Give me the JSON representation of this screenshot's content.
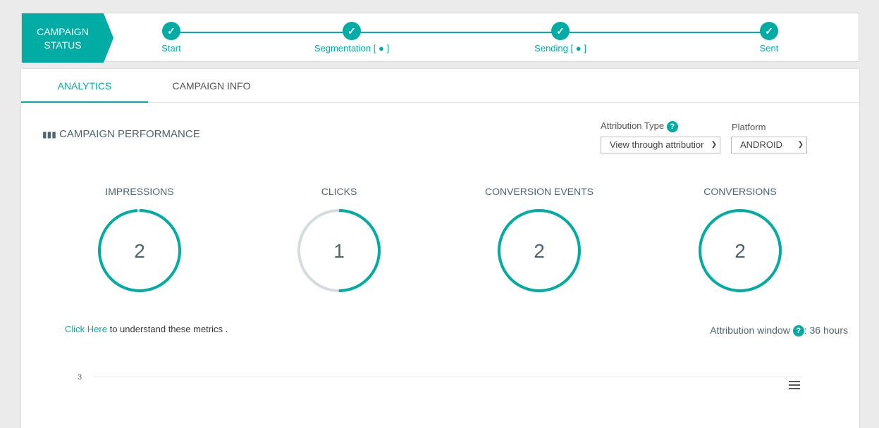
{
  "status": {
    "badge": "CAMPAIGN STATUS",
    "steps": [
      {
        "label": "Start",
        "android": false
      },
      {
        "label": "Segmentation [",
        "android": true
      },
      {
        "label": "Sending [",
        "android": true
      },
      {
        "label": "Sent",
        "android": false
      }
    ]
  },
  "tabs": [
    {
      "label": "ANALYTICS",
      "active": true
    },
    {
      "label": "CAMPAIGN INFO",
      "active": false
    }
  ],
  "section_title": "CAMPAIGN PERFORMANCE",
  "attribution": {
    "label": "Attribution Type",
    "value": "View through attributior"
  },
  "platform": {
    "label": "Platform",
    "value": "ANDROID"
  },
  "metrics": [
    {
      "name": "IMPRESSIONS",
      "value": "2",
      "fill": 0.99
    },
    {
      "name": "CLICKS",
      "value": "1",
      "fill": 0.5
    },
    {
      "name": "CONVERSION EVENTS",
      "value": "2",
      "fill": 1
    },
    {
      "name": "CONVERSIONS",
      "value": "2",
      "fill": 1
    }
  ],
  "note": {
    "link": "Click Here",
    "text": " to understand these metrics ."
  },
  "window": {
    "label": "Attribution window",
    "value": ": 36 hours"
  },
  "chart": {
    "ytick": "3"
  },
  "colors": {
    "accent": "#00aca3",
    "track": "#d3dde0"
  }
}
